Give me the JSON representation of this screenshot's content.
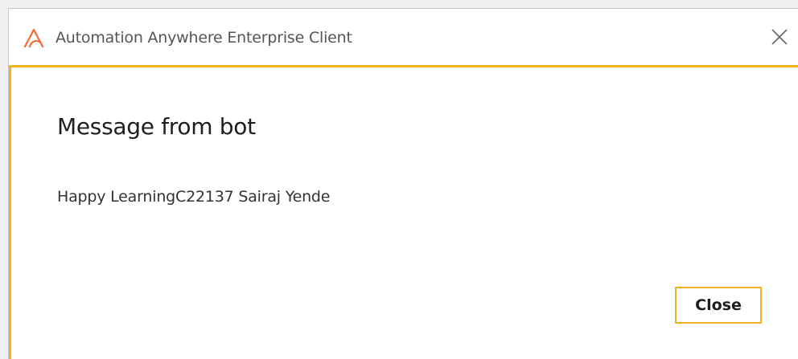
{
  "window": {
    "title": "Automation Anywhere Enterprise Client",
    "logo_icon": "automation-anywhere-logo",
    "close_icon": "close-x-icon"
  },
  "dialog": {
    "heading": "Message from bot",
    "message": "Happy LearningC22137 Sairaj Yende",
    "close_button_label": "Close"
  },
  "colors": {
    "accent": "#f2b01e",
    "logo": "#f26a3a",
    "background": "#ffffff"
  }
}
